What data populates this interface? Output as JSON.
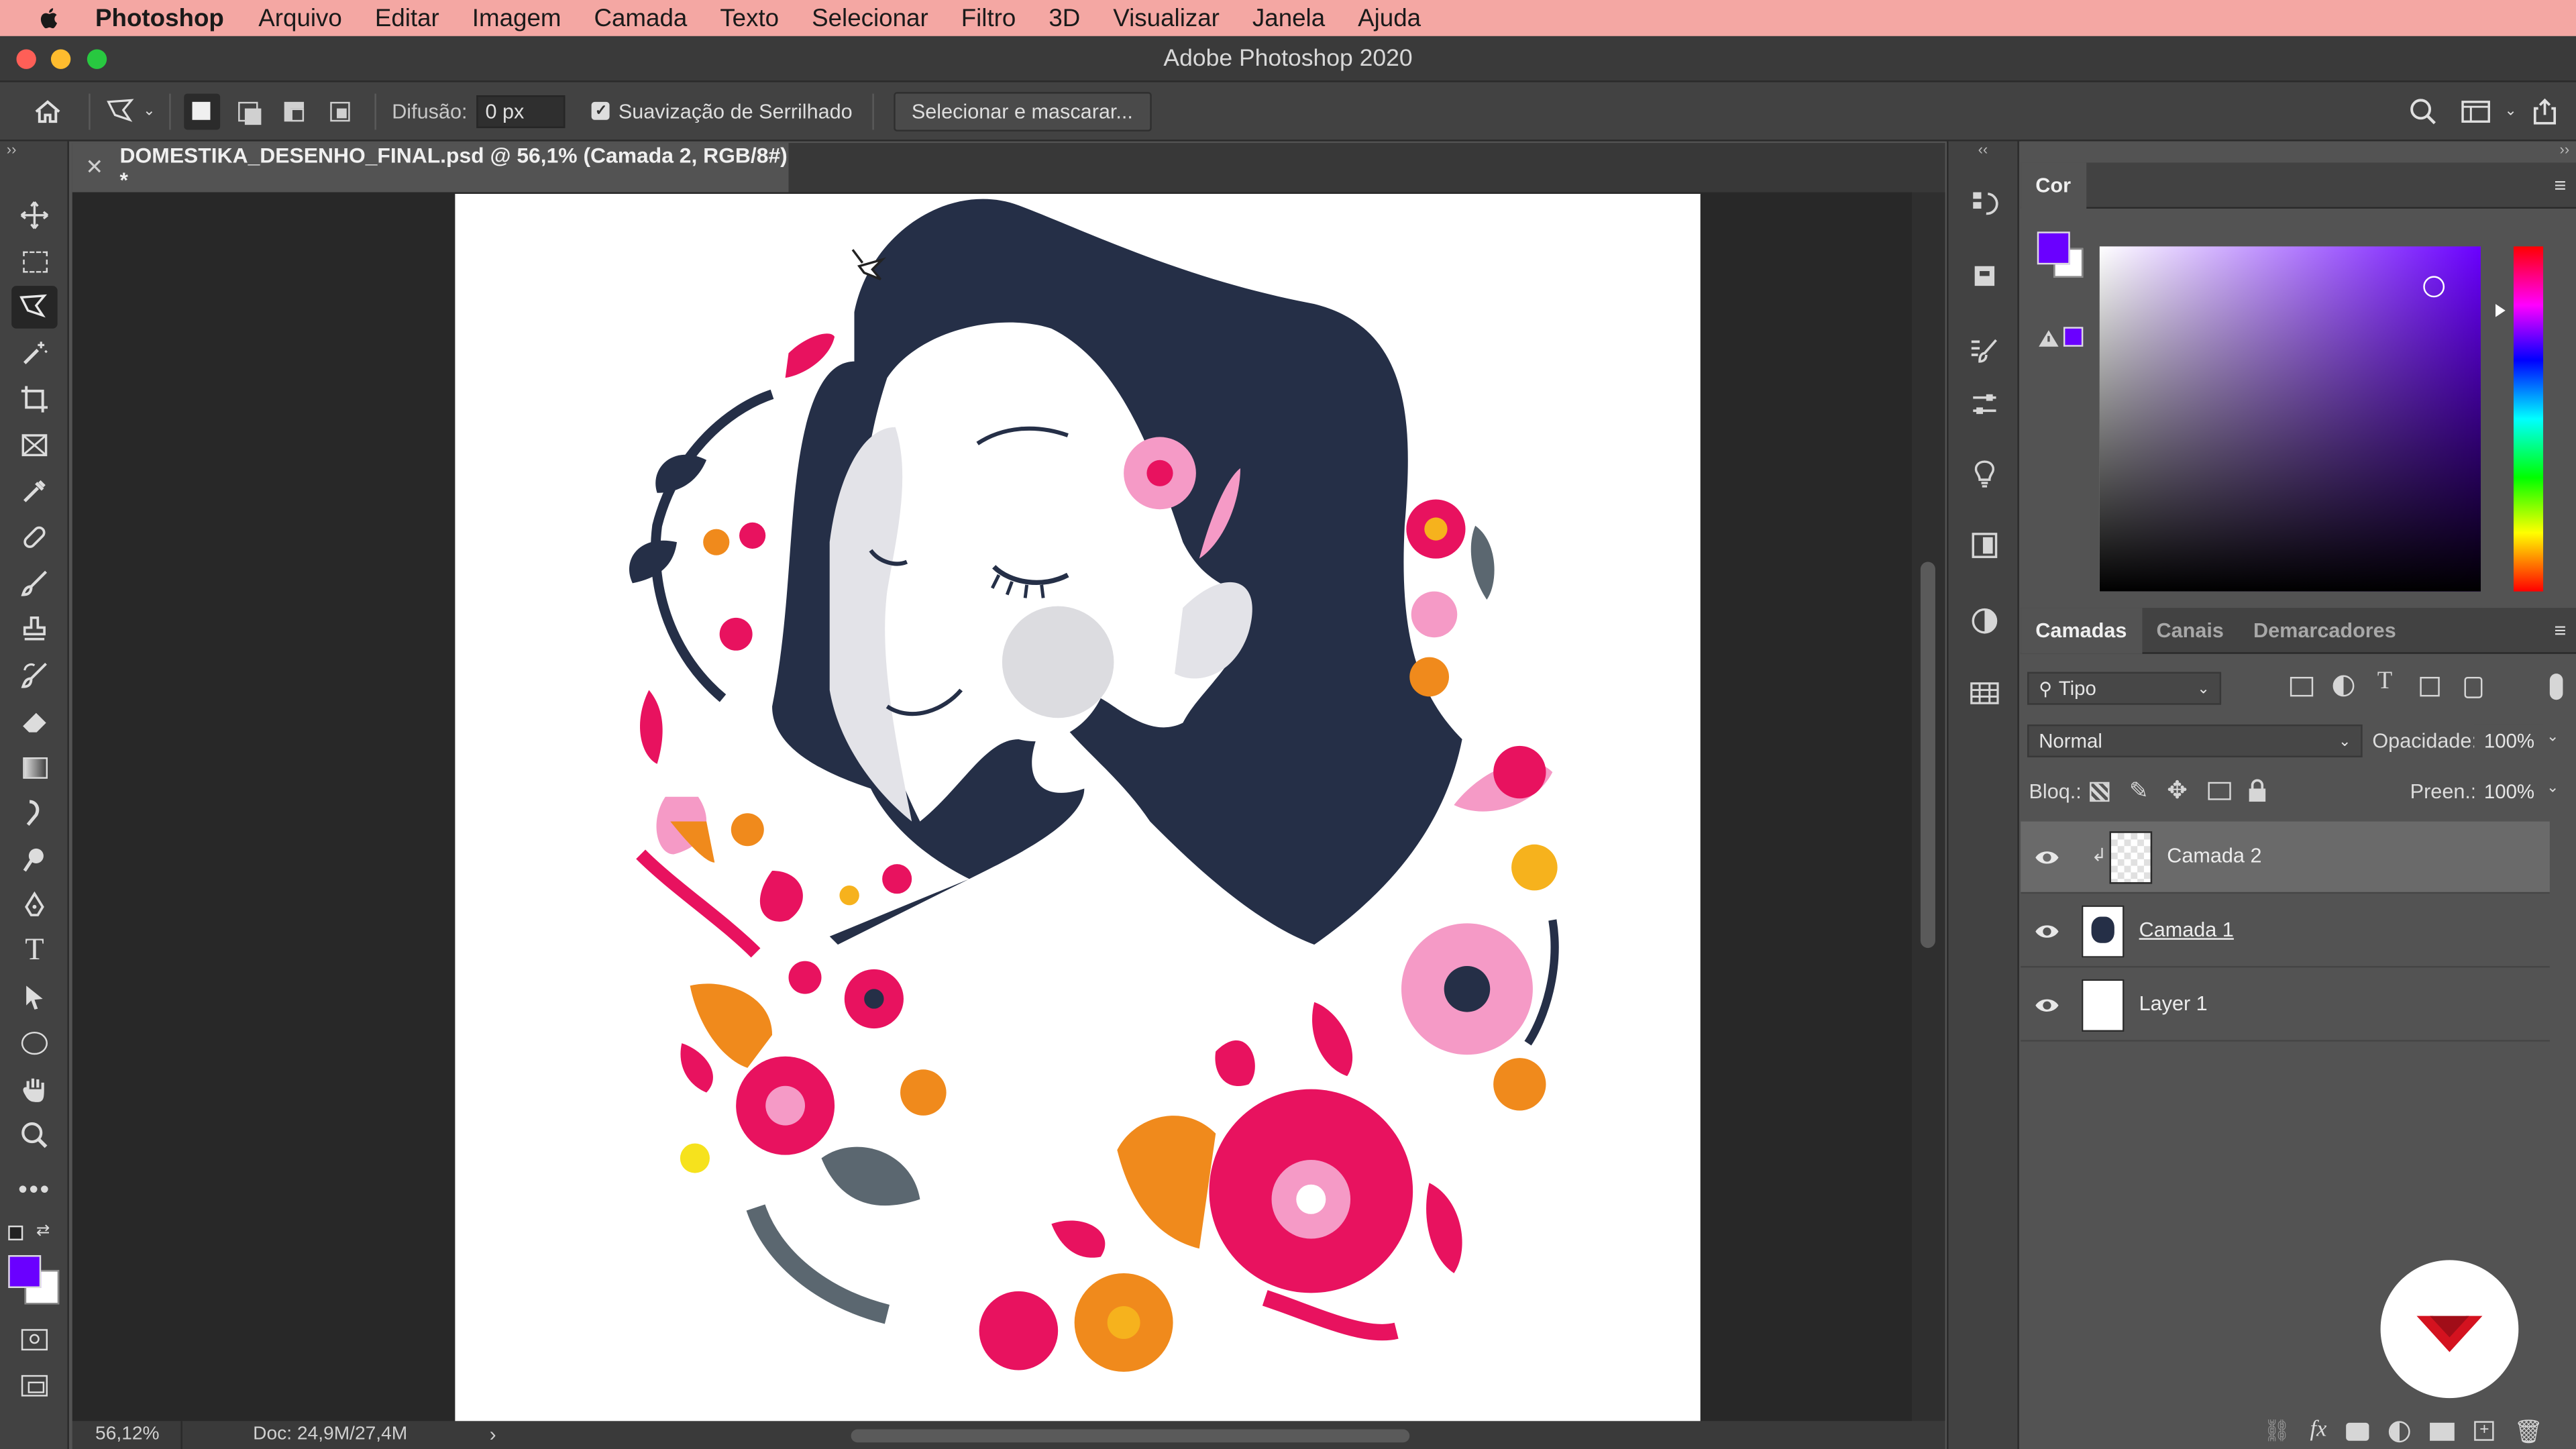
{
  "menubar": {
    "app": "Photoshop",
    "items": [
      "Arquivo",
      "Editar",
      "Imagem",
      "Camada",
      "Texto",
      "Selecionar",
      "Filtro",
      "3D",
      "Visualizar",
      "Janela",
      "Ajuda"
    ]
  },
  "window": {
    "title": "Adobe Photoshop 2020"
  },
  "options": {
    "feather_label": "Difusão:",
    "feather_value": "0 px",
    "antialias_label": "Suavização de Serrilhado",
    "antialias_checked": true,
    "select_mask_label": "Selecionar e mascarar..."
  },
  "document": {
    "tab_label": "DOMESTIKA_DESENHO_FINAL.psd @ 56,1% (Camada 2, RGB/8#) *",
    "zoom": "56,12%",
    "doc_size": "Doc: 24,9M/27,4M"
  },
  "color_panel": {
    "tab": "Cor",
    "foreground": "#6a00ff",
    "background": "#ffffff"
  },
  "layers_panel": {
    "tabs": [
      "Camadas",
      "Canais",
      "Demarcadores"
    ],
    "filter_kind": "Tipo",
    "blend_mode": "Normal",
    "opacity_label": "Opacidade:",
    "opacity_value": "100%",
    "lock_label": "Bloq.:",
    "fill_label": "Preen.:",
    "fill_value": "100%",
    "layers": [
      {
        "name": "Camada 2",
        "visible": true,
        "selected": true
      },
      {
        "name": "Camada 1",
        "visible": true,
        "selected": false
      },
      {
        "name": "Layer 1",
        "visible": true,
        "selected": false
      }
    ]
  },
  "colors": {
    "menubar": "#f4a7a3",
    "hair": "#252f47",
    "pink": "#e8125f",
    "orange": "#f08a1c",
    "brand_red": "#d4121f"
  }
}
